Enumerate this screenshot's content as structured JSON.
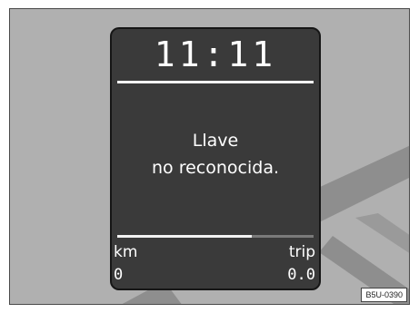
{
  "colors": {
    "background": "#b0b0b0",
    "display": "#3a3a3a",
    "display_border": "#161616",
    "text": "#ffffff",
    "road_lines": "#8e8e8e"
  },
  "display": {
    "clock": "11:11",
    "message_line1": "Llave",
    "message_line2": "no reconocida.",
    "odometer_label": "km",
    "odometer_value": "0",
    "trip_label": "trip",
    "trip_value": "0.0"
  },
  "figure_code": "B5U-0390"
}
